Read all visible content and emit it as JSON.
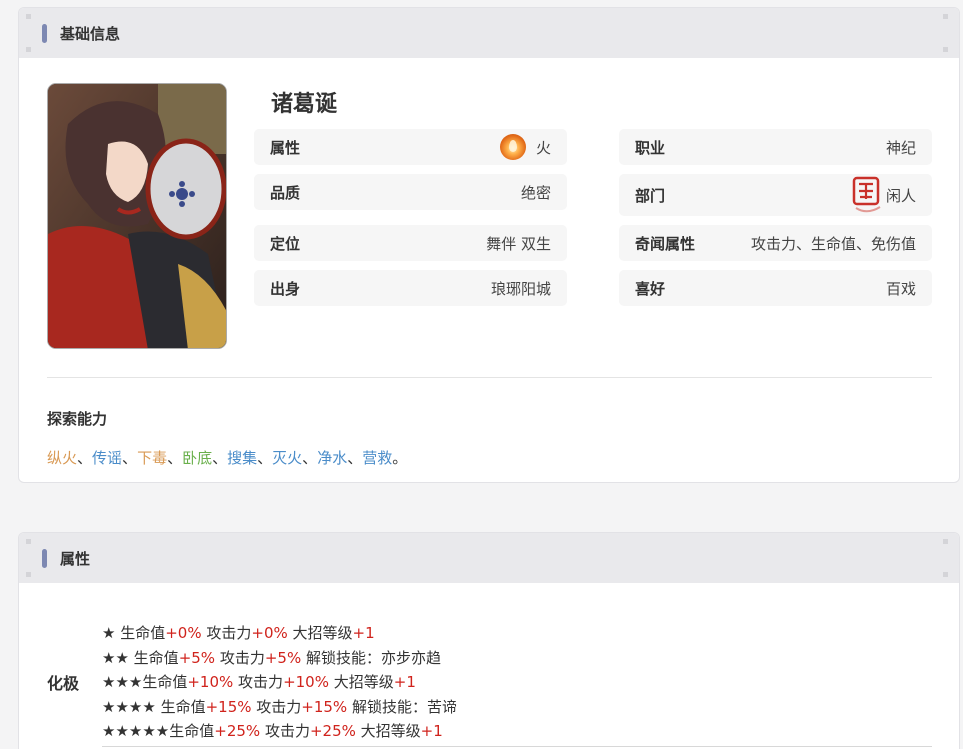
{
  "basic": {
    "section_title": "基础信息",
    "name": "诸葛诞",
    "rows": {
      "attribute": {
        "label": "属性",
        "value": "火"
      },
      "quality": {
        "label": "品质",
        "value": "绝密"
      },
      "position": {
        "label": "定位",
        "value": "舞伴 双生"
      },
      "origin": {
        "label": "出身",
        "value": "琅琊阳城"
      },
      "job": {
        "label": "职业",
        "value": "神纪"
      },
      "department": {
        "label": "部门",
        "value": "闲人"
      },
      "anecdote": {
        "label": "奇闻属性",
        "value": "攻击力、生命值、免伤值"
      },
      "hobby": {
        "label": "喜好",
        "value": "百戏"
      }
    },
    "explore_title": "探索能力",
    "explore_items": [
      {
        "text": "纵火",
        "color": "#d99a55"
      },
      {
        "text": "传谣",
        "color": "#4a8cc9"
      },
      {
        "text": "下毒",
        "color": "#d99a55"
      },
      {
        "text": "卧底",
        "color": "#6ab04c"
      },
      {
        "text": "搜集",
        "color": "#4a8cc9"
      },
      {
        "text": "灭火",
        "color": "#4a8cc9"
      },
      {
        "text": "净水",
        "color": "#4a8cc9"
      },
      {
        "text": "营救",
        "color": "#4a8cc9"
      }
    ],
    "explore_sep": "、",
    "explore_end": "。"
  },
  "attributes": {
    "section_title": "属性",
    "huaji_label": "化极",
    "stars": [
      {
        "stars": "★ ",
        "p1": "生命值",
        "v1": "+0%",
        "p2": " 攻击力",
        "v2": "+0%",
        "p3": " 大招等级",
        "v3": "+1"
      },
      {
        "stars": "★★ ",
        "p1": "生命值",
        "v1": "+5%",
        "p2": " 攻击力",
        "v2": "+5%",
        "p3": " 解锁技能：亦步亦趋",
        "v3": ""
      },
      {
        "stars": "★★★",
        "p1": "生命值",
        "v1": "+10%",
        "p2": " 攻击力",
        "v2": "+10%",
        "p3": " 大招等级",
        "v3": "+1"
      },
      {
        "stars": "★★★★ ",
        "p1": "生命值",
        "v1": "+15%",
        "p2": " 攻击力",
        "v2": "+15%",
        "p3": " 解锁技能：苦谛",
        "v3": ""
      },
      {
        "stars": "★★★★★",
        "p1": "生命值",
        "v1": "+25%",
        "p2": " 攻击力",
        "v2": "+25%",
        "p3": " 大招等级",
        "v3": "+1"
      }
    ]
  },
  "colors": {
    "accent_bar": "#7d88b2",
    "header_bg": "#e9e9ec",
    "positive_red": "#d0231c"
  }
}
